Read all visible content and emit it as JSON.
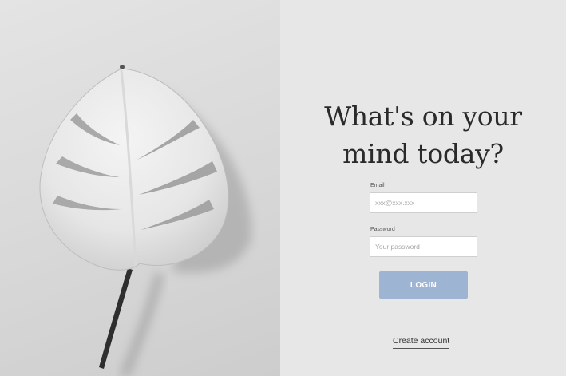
{
  "hero": {
    "image": "monstera-leaf-photo",
    "headline_line1": "What's on your",
    "headline_line2": "mind today?"
  },
  "form": {
    "email_label": "Email",
    "email_placeholder": "xxx@xxx.xxx",
    "password_label": "Password",
    "password_placeholder": "Your password",
    "login_label": "LOGIN",
    "create_account_label": "Create account"
  },
  "colors": {
    "button": "#9db4d2",
    "background": "#e7e7e7",
    "heading": "#2a2a2a"
  }
}
